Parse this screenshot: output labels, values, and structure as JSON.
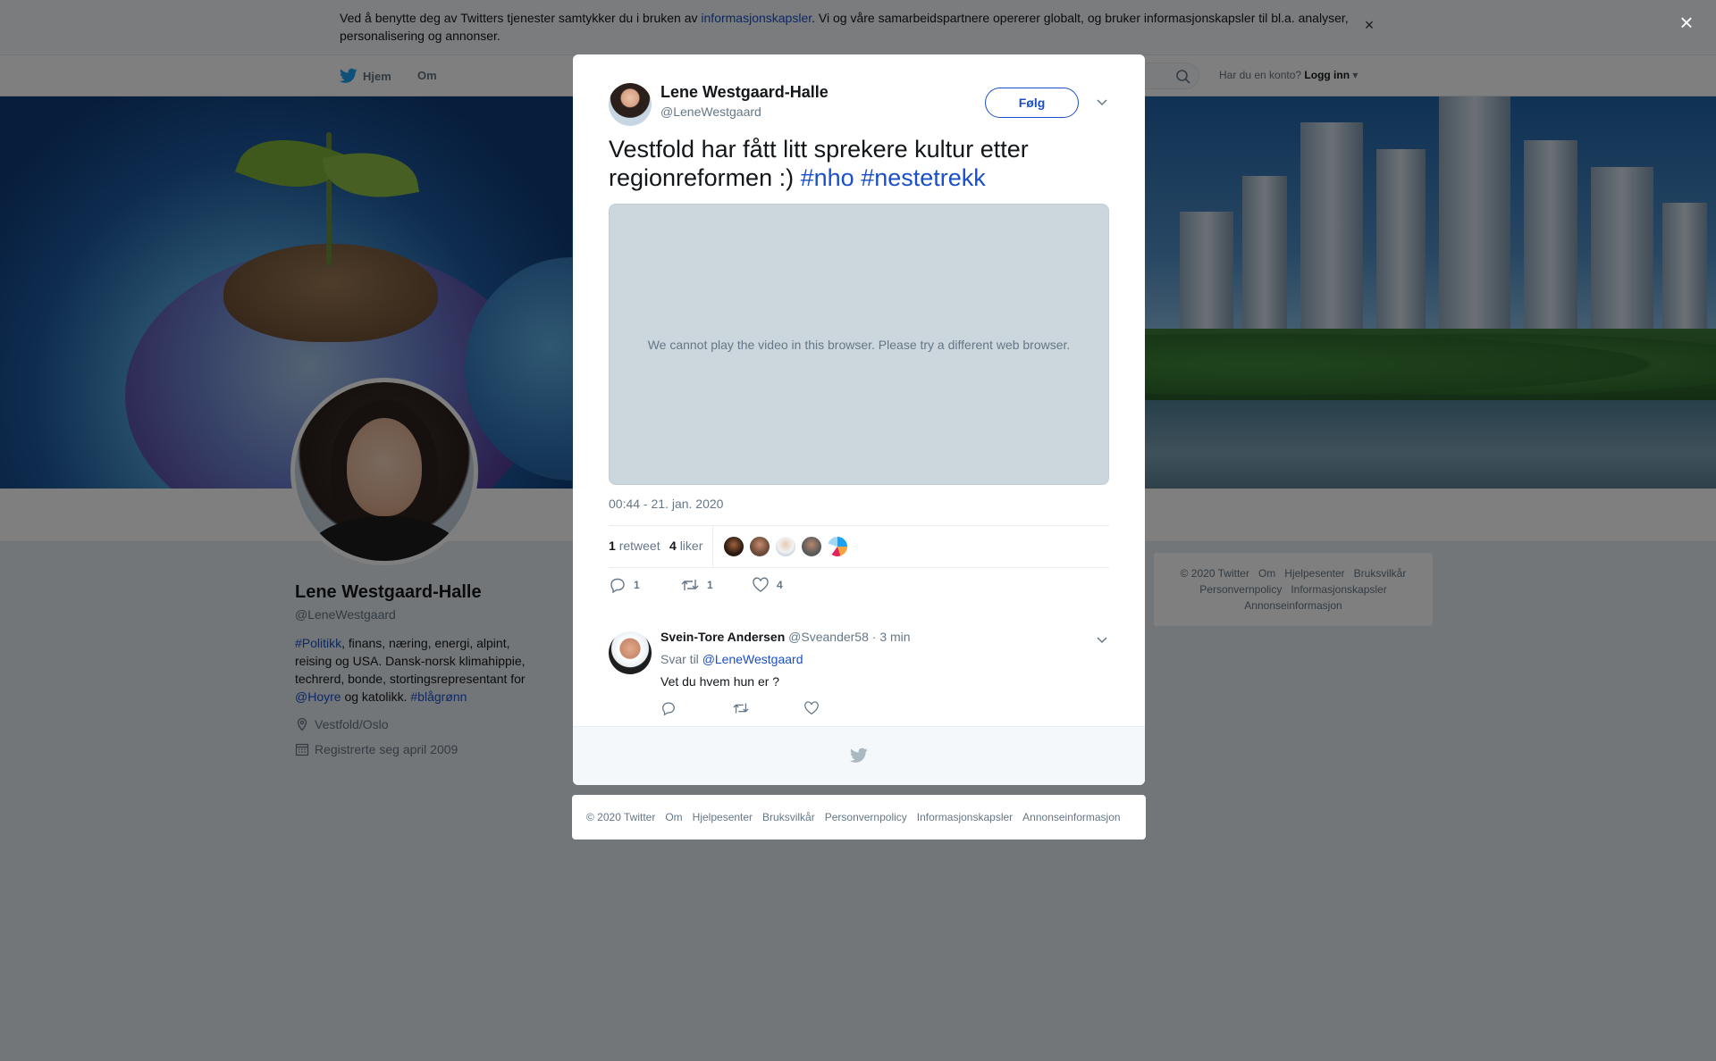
{
  "cookie_banner": {
    "text_before": "Ved å benytte deg av Twitters tjenester samtykker du i bruken av ",
    "link": "informasjonskapsler",
    "text_after": ". Vi og våre samarbeidspartnere opererer globalt, og bruker informasjonskapsler til bl.a. analyser, personalisering og annonser.",
    "close": "×"
  },
  "topnav": {
    "home": "Hjem",
    "about": "Om",
    "account_prompt": "Har du en konto?",
    "login": "Logg inn"
  },
  "profile": {
    "name": "Lene Westgaard-Halle",
    "handle": "@LeneWestgaard",
    "bio": {
      "tag1": "#Politikk",
      "text1": ", finans, næring, energi, alpint, reising og USA. Dansk-norsk klimahippie, techrerd, bonde, stortingsrepresentant for ",
      "mention": "@Hoyre",
      "text2": " og katolikk. ",
      "tag2": "#blågrønn"
    },
    "location": "Vestfold/Oslo",
    "joined": "Registrerte seg april 2009"
  },
  "side_footer": {
    "links": [
      "© 2020 Twitter",
      "Om",
      "Hjelpesenter",
      "Bruksvilkår",
      "Personvernpolicy",
      "Informasjonskapsler",
      "Annonseinformasjon"
    ]
  },
  "overlay": {
    "close": "×"
  },
  "tweet": {
    "author_name": "Lene Westgaard-Halle",
    "author_handle": "@LeneWestgaard",
    "follow_label": "Følg",
    "text": "Vestfold har fått litt sprekere kultur etter regionreformen :) ",
    "hashtag1": "#nho",
    "hashtag2": "#nestetrekk",
    "video_message": "We cannot play the video in this browser. Please try a different web browser.",
    "timestamp": "00:44 - 21. jan. 2020",
    "retweets_count": "1",
    "retweets_label": "retweet",
    "likes_count": "4",
    "likes_label": "liker",
    "reply_count": "1",
    "retweet_count": "1",
    "like_count": "4"
  },
  "reply": {
    "author_name": "Svein-Tore Andersen",
    "author_handle": "@Sveander58",
    "time": "· 3 min",
    "reply_to_label": "Svar til",
    "reply_to_handle": "@LeneWestgaard",
    "text": "Vet du hvem hun er ?"
  },
  "modal_footer": {
    "links": [
      "© 2020 Twitter",
      "Om",
      "Hjelpesenter",
      "Bruksvilkår",
      "Personvernpolicy",
      "Informasjonskapsler",
      "Annonseinformasjon"
    ]
  },
  "colors": {
    "link": "#1b4fc8",
    "twitter_blue": "#1da1f2",
    "muted": "#657786"
  }
}
